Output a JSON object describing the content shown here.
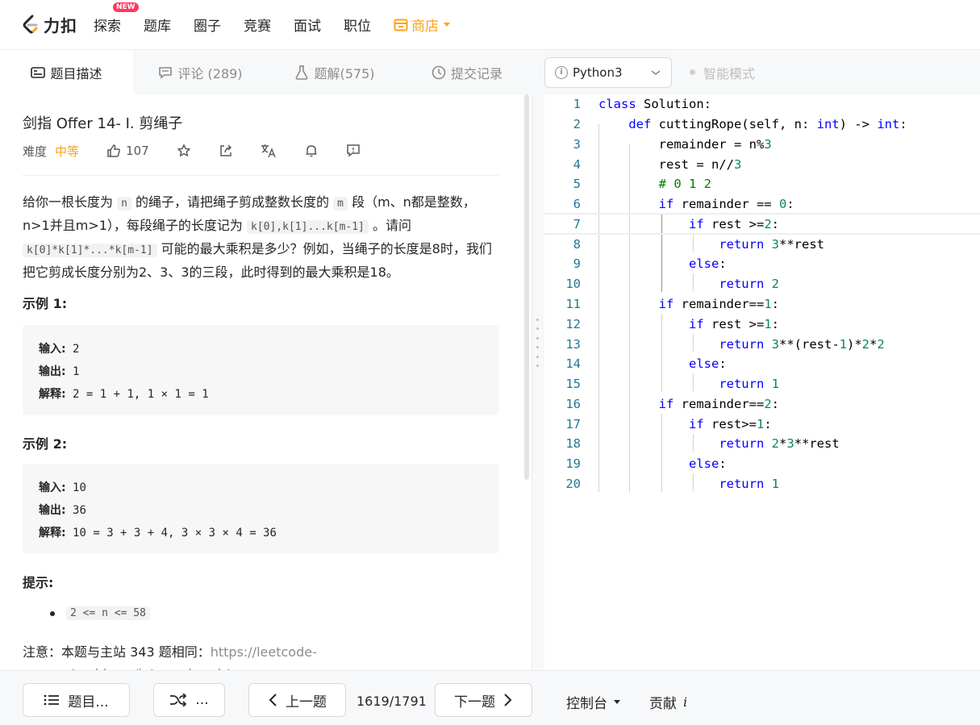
{
  "nav": {
    "logo_text": "力扣",
    "items": [
      "探索",
      "题库",
      "圈子",
      "竞赛",
      "面试",
      "职位"
    ],
    "new_badge": "NEW",
    "shop": "商店",
    "shop_color": "#ffa116"
  },
  "tabs": [
    {
      "label": "题目描述",
      "icon": "description-icon"
    },
    {
      "label": "评论 (289)",
      "icon": "comment-icon"
    },
    {
      "label": "题解(575)",
      "icon": "flask-icon"
    },
    {
      "label": "提交记录",
      "icon": "clock-icon"
    }
  ],
  "problem": {
    "title": "剑指 Offer 14- I. 剪绳子",
    "difficulty_label": "难度",
    "difficulty": "中等",
    "likes": "107",
    "desc": {
      "p1": "给你一根长度为",
      "c1": "n",
      "p2": "的绳子，请把绳子剪成整数长度的",
      "c2": "m",
      "p3": "段（m、n都是整数，n>1并且m>1），每段绳子的长度记为",
      "c3": "k[0],k[1]...k[m-1]",
      "p4": "。请问",
      "c4": "k[0]*k[1]*...*k[m-1]",
      "p5": "可能的最大乘积是多少？例如，当绳子的长度是8时，我们把它剪成长度分别为2、3、3的三段，此时得到的最大乘积是18。"
    },
    "example1": {
      "heading": "示例 1:",
      "in_label": "输入:",
      "in": "2",
      "out_label": "输出:",
      "out": "1",
      "exp_label": "解释:",
      "exp": "2 = 1 + 1, 1 × 1 = 1"
    },
    "example2": {
      "heading": "示例 2:",
      "in_label": "输入:",
      "in": "10",
      "out_label": "输出:",
      "out": "36",
      "exp_label": "解释:",
      "exp": "10 = 3 + 3 + 4, 3 × 3 × 4 = 36"
    },
    "hint_heading": "提示:",
    "hint": "2 <= n <= 58",
    "note_prefix": "注意：本题与主站 343 题相同：",
    "note_link": "https://leetcode-cn.com/problems/integer-break/"
  },
  "editor": {
    "language": "Python3",
    "smart_mode": "智能模式",
    "line_numbers": [
      "1",
      "2",
      "3",
      "4",
      "5",
      "6",
      "7",
      "8",
      "9",
      "10",
      "11",
      "12",
      "13",
      "14",
      "15",
      "16",
      "17",
      "18",
      "19",
      "20"
    ]
  },
  "bottom": {
    "list_btn": "题目...",
    "random_btn": "...",
    "prev_btn": "上一题",
    "pager": "1619/1791",
    "next_btn": "下一题",
    "console": "控制台",
    "contribute": "贡献",
    "contribute_icon": "i"
  }
}
